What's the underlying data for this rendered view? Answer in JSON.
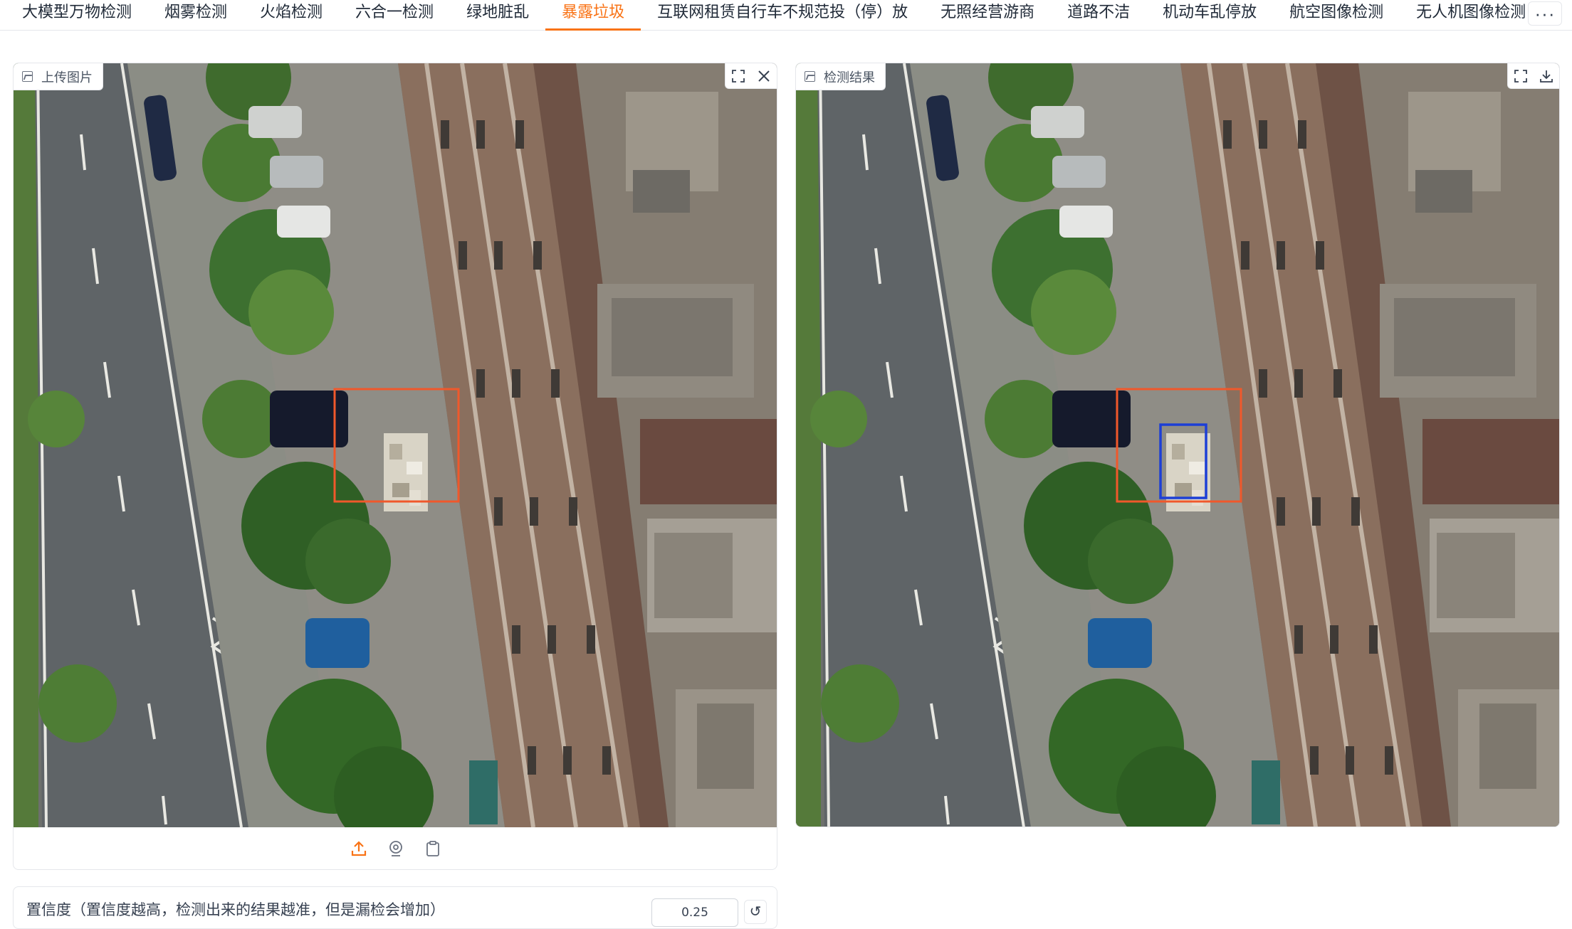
{
  "tabs": [
    {
      "label": "大模型万物检测"
    },
    {
      "label": "烟雾检测"
    },
    {
      "label": "火焰检测"
    },
    {
      "label": "六合一检测"
    },
    {
      "label": "绿地脏乱"
    },
    {
      "label": "暴露垃圾"
    },
    {
      "label": "互联网租赁自行车不规范投（停）放"
    },
    {
      "label": "无照经营游商"
    },
    {
      "label": "道路不洁"
    },
    {
      "label": "机动车乱停放"
    },
    {
      "label": "航空图像检测"
    },
    {
      "label": "无人机图像检测"
    }
  ],
  "active_tab_index": 5,
  "more_label": "···",
  "upload_panel": {
    "label": "上传图片"
  },
  "result_panel": {
    "label": "检测结果"
  },
  "confidence": {
    "label": "置信度（置信度越高，检测出来的结果越准，但是漏检会增加）",
    "value": "0.25",
    "reset_symbol": "↺"
  },
  "colors": {
    "accent": "#f97316",
    "roi_box": "#f0582b",
    "detection_box": "#1d3fd6"
  },
  "icons": {
    "fullscreen": "fullscreen-icon",
    "close": "close-icon",
    "download": "download-icon",
    "upload": "upload-icon",
    "webcam": "webcam-icon",
    "clipboard": "clipboard-icon",
    "image": "image-icon"
  }
}
